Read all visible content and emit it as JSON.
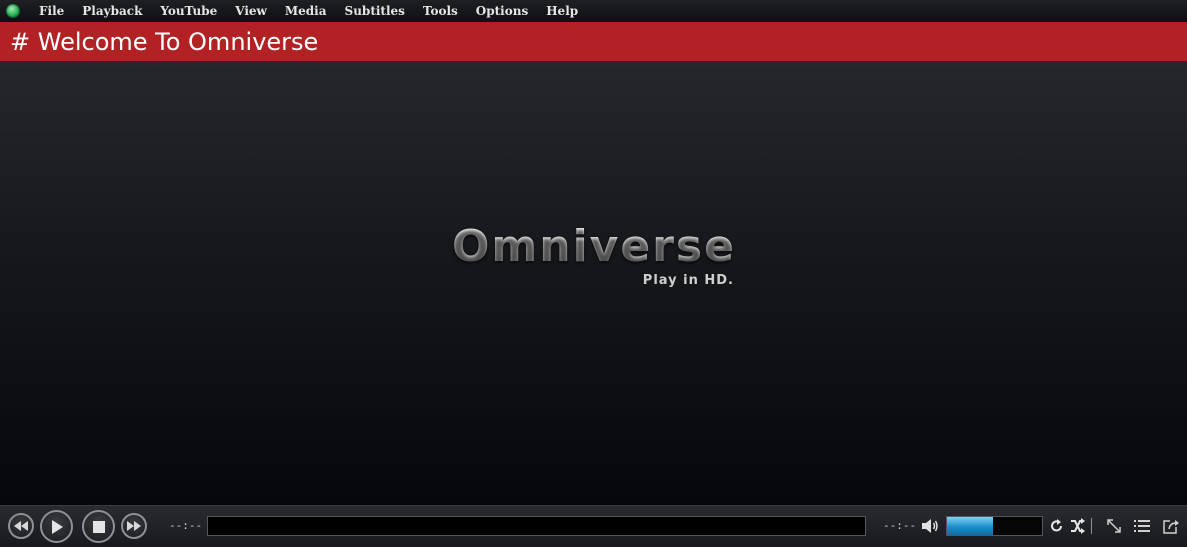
{
  "menu": {
    "items": [
      "File",
      "Playback",
      "YouTube",
      "View",
      "Media",
      "Subtitles",
      "Tools",
      "Options",
      "Help"
    ]
  },
  "title_banner": {
    "text": "# Welcome To Omniverse",
    "color": "#b22224"
  },
  "splash": {
    "logo_text": "Omniverse",
    "tagline": "Play in HD."
  },
  "controls": {
    "elapsed_time": "--:--",
    "total_time": "--:--",
    "seek_progress": 0,
    "volume_level": 0.48,
    "volume_color": "#2aa3d9",
    "icons": [
      "rewind-icon",
      "play-icon",
      "stop-icon",
      "fast-forward-icon",
      "volume-icon",
      "repeat-icon",
      "shuffle-icon",
      "fullscreen-icon",
      "playlist-icon",
      "popout-icon"
    ]
  }
}
